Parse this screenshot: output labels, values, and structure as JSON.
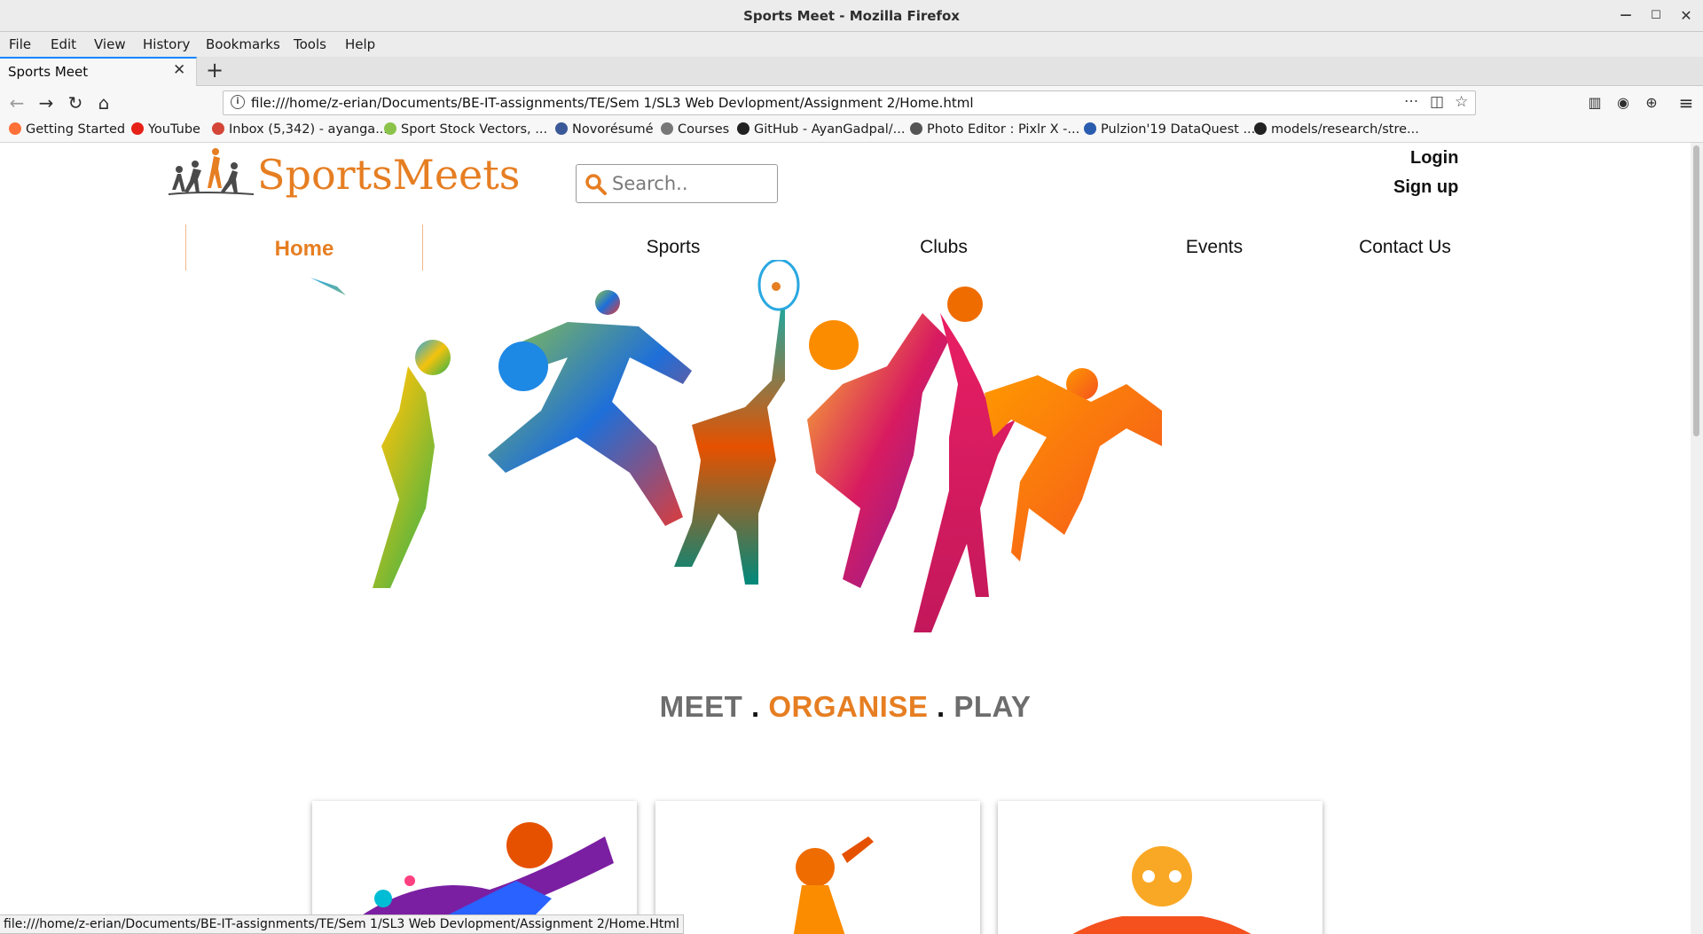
{
  "window": {
    "title": "Sports Meet - Mozilla Firefox"
  },
  "menu": [
    "File",
    "Edit",
    "View",
    "History",
    "Bookmarks",
    "Tools",
    "Help"
  ],
  "tab": {
    "title": "Sports Meet"
  },
  "url": "file:///home/z-erian/Documents/BE-IT-assignments/TE/Sem 1/SL3 Web Devlopment/Assignment 2/Home.html",
  "bookmarks": [
    {
      "label": "Getting Started",
      "color": "#ff7139"
    },
    {
      "label": "YouTube",
      "color": "#e62117"
    },
    {
      "label": "Inbox (5,342) - ayanga...",
      "color": "#d44638"
    },
    {
      "label": "Sport Stock Vectors, ...",
      "color": "#8bc34a"
    },
    {
      "label": "Novorésumé",
      "color": "#3b5998"
    },
    {
      "label": "Courses",
      "color": "#777777"
    },
    {
      "label": "GitHub - AyanGadpal/...",
      "color": "#222222"
    },
    {
      "label": "Photo Editor : Pixlr X -...",
      "color": "#555555"
    },
    {
      "label": "Pulzion'19 DataQuest ...",
      "color": "#2a5db0"
    },
    {
      "label": "models/research/stre...",
      "color": "#222222"
    }
  ],
  "site": {
    "logo_text": "SportsMeets",
    "search_placeholder": "Search..",
    "login": "Login",
    "signup": "Sign up",
    "nav": [
      "Home",
      "Sports",
      "Clubs",
      "Events",
      "Contact Us"
    ],
    "tagline": {
      "meet": "MEET",
      "dot1": ".",
      "organise": "ORGANISE",
      "dot2": ".",
      "play": "PLAY"
    },
    "brand_color": "#e67e22",
    "grey_color": "#6d6d6d"
  },
  "status_url": "file:///home/z-erian/Documents/BE-IT-assignments/TE/Sem 1/SL3 Web Devlopment/Assignment 2/Home.Html"
}
